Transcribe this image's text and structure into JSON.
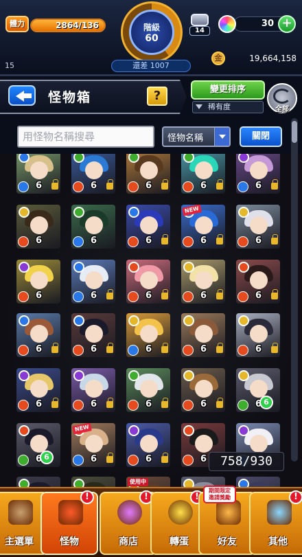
{
  "hud": {
    "stamina_label": "體力",
    "stamina_text": "2864/136",
    "stamina_fraction": 1.0,
    "rank_label": "階級",
    "rank_value": "60",
    "exp_to_next": "還差 1007",
    "orb_box_count": "14",
    "orb_count": "30",
    "plus_label": "+",
    "friend_count": "15",
    "coin_symbol": "金",
    "gold": "19,664,158"
  },
  "header": {
    "title": "怪物箱",
    "help_label": "?",
    "sort_button": "變更排序",
    "sort_by": "稀有度",
    "all_label": "全部"
  },
  "search": {
    "placeholder": "用怪物名稱搜尋",
    "field_select": "怪物名稱",
    "close_label": "關閉"
  },
  "box": {
    "count_text": "758/930",
    "new_label": "NEW",
    "inuse_label": "使用中"
  },
  "colors": {
    "accent_orange": "#f6a91e",
    "accent_blue": "#1f86ff",
    "accent_green": "#2ed14a"
  },
  "grid": {
    "rows": [
      [
        {
          "elem": "water",
          "level": "6",
          "hair": "#d7c08a",
          "bg": "#7a9a6a",
          "bottom": "water",
          "lock": true
        },
        {
          "elem": "wood",
          "level": "6",
          "hair": "#2a7ad6",
          "bg": "#3a5a9a",
          "bottom": "fire",
          "lock": true
        },
        {
          "elem": "wood",
          "level": "6",
          "hair": "#5a3a1e",
          "bg": "#b07a3a",
          "bottom": "fire",
          "lock": true
        },
        {
          "elem": "wood",
          "level": "6",
          "hair": "#2ad6b8",
          "bg": "#4a9aa8",
          "bottom": "fire",
          "lock": true
        },
        {
          "elem": "dark",
          "level": "6",
          "hair": "#c59ad6",
          "bg": "#6a4a8a",
          "bottom": "water",
          "lock": true
        }
      ],
      [
        {
          "elem": "light",
          "level": "6",
          "hair": "#3a2a1a",
          "bg": "#5a5a3a",
          "bottom": "fire",
          "lock": false
        },
        {
          "elem": "wood",
          "level": "6",
          "hair": "#1a3a2a",
          "bg": "#3a6a4a",
          "bottom": "water",
          "lock": false
        },
        {
          "elem": "water",
          "level": "6",
          "hair": "#2a3ab8",
          "bg": "#3a4aa8",
          "bottom": "fire",
          "lock": true
        },
        {
          "elem": "water",
          "level": "6",
          "hair": "#2a6ad6",
          "bg": "#3a6ac8",
          "bottom": "fire",
          "lock": true,
          "new": true
        },
        {
          "elem": "light",
          "level": "6",
          "hair": "#e0e0ea",
          "bg": "#7a8a9a",
          "bottom": "fire",
          "lock": true
        }
      ],
      [
        {
          "elem": "dark",
          "level": "6",
          "hair": "#f2d24a",
          "bg": "#9a8a3a",
          "bottom": "fire",
          "lock": false
        },
        {
          "elem": "water",
          "level": "6",
          "hair": "#e6ecf5",
          "bg": "#5a7ab8",
          "bottom": "water",
          "lock": true
        },
        {
          "elem": "fire",
          "level": "6",
          "hair": "#f09aa8",
          "bg": "#c86a7a",
          "bottom": "fire",
          "lock": true
        },
        {
          "elem": "light",
          "level": "6",
          "hair": "#f2e2a8",
          "bg": "#a89a6a",
          "bottom": "fire",
          "lock": true
        },
        {
          "elem": "fire",
          "level": "6",
          "hair": "#2a1a1a",
          "bg": "#8a4a4a",
          "bottom": "fire",
          "lock": true
        }
      ],
      [
        {
          "elem": "water",
          "level": "6",
          "hair": "#9a5a3a",
          "bg": "#5a7aa8",
          "bottom": "fire",
          "lock": true
        },
        {
          "elem": "water",
          "level": "6",
          "hair": "#1a1a2a",
          "bg": "#5a3a3a",
          "bottom": "fire",
          "lock": true
        },
        {
          "elem": "light",
          "level": "6",
          "hair": "#f2c24a",
          "bg": "#d89a3a",
          "bottom": "water",
          "lock": true
        },
        {
          "elem": "light",
          "level": "6",
          "hair": "#8a5a3a",
          "bg": "#9a7a5a",
          "bottom": "fire",
          "lock": true
        },
        {
          "elem": "light",
          "level": "6",
          "hair": "#2a2a3a",
          "bg": "#aab0c0",
          "bottom": "fire",
          "lock": true
        }
      ],
      [
        {
          "elem": "dark",
          "level": "6",
          "hair": "#e6c86a",
          "bg": "#3a4a8a",
          "bottom": "fire",
          "lock": true
        },
        {
          "elem": "dark",
          "level": "6",
          "hair": "#c8d8e6",
          "bg": "#7a5aa8",
          "bottom": "fire",
          "lock": true
        },
        {
          "elem": "wood",
          "level": "6",
          "hair": "#e0e6ea",
          "bg": "#5a8a5a",
          "bottom": "fire",
          "lock": true
        },
        {
          "elem": "light",
          "level": "6",
          "hair": "#9a6a3a",
          "bg": "#6a5a4a",
          "bottom": "fire",
          "lock": true
        },
        {
          "elem": "light",
          "level": "6",
          "hair": "#c8c8d0",
          "bg": "#5a5a6a",
          "bottom": "wood",
          "lock": false,
          "badge": "6"
        }
      ],
      [
        {
          "elem": "fire",
          "level": "6",
          "hair": "#1a1a2a",
          "bg": "#5a5a6a",
          "bottom": "wood",
          "lock": false,
          "badge": "6"
        },
        {
          "elem": "fire",
          "level": "6",
          "hair": "#d8b08a",
          "bg": "#a07a5a",
          "bottom": "water",
          "lock": true,
          "new": true
        },
        {
          "elem": "dark",
          "level": "6",
          "hair": "#2a3a8a",
          "bg": "#4a5aa8",
          "bottom": "fire",
          "lock": true
        },
        {
          "elem": "fire",
          "level": "6",
          "hair": "#1a1a1a",
          "bg": "#7a3a3a",
          "bottom": "fire",
          "lock": false
        },
        {
          "elem": "dark",
          "level": "",
          "hair": "#f0f0f5",
          "bg": "#7a8ab0",
          "bottom": "water",
          "lock": false
        }
      ],
      [
        {
          "elem": "wood",
          "level": "",
          "hair": "#1a1a2a",
          "bg": "#3a3a4a",
          "bottom": "",
          "lock": false
        },
        {
          "elem": "wood",
          "level": "",
          "hair": "#2a2a1a",
          "bg": "#4a4a3a",
          "bottom": "",
          "lock": false
        },
        {
          "elem": "fire",
          "level": "",
          "hair": "#5a3a2a",
          "bg": "#6a4a3a",
          "bottom": "",
          "lock": false,
          "inuse": true
        },
        {
          "elem": "light",
          "level": "",
          "hair": "#8a8a9a",
          "bg": "#5a5a6a",
          "bottom": "",
          "lock": false
        },
        {
          "elem": "water",
          "level": "",
          "hair": "#3a3a5a",
          "bg": "#4a4a6a",
          "bottom": "",
          "lock": false
        }
      ]
    ]
  },
  "nav": {
    "items": [
      {
        "label": "主選單",
        "icon": "home-icon",
        "color": "#c8a070",
        "badge": ""
      },
      {
        "label": "怪物",
        "icon": "monster-icon",
        "color": "#ff5a2a",
        "badge": "!",
        "active": true
      },
      {
        "label": "商店",
        "icon": "shop-orb-icon",
        "color": "#e07aff",
        "badge": "!"
      },
      {
        "label": "轉蛋",
        "icon": "gacha-egg-icon",
        "color": "#ffe04a",
        "badge": "!"
      },
      {
        "label": "好友",
        "icon": "friends-icon",
        "color": "#ffb84a",
        "badge": ""
      },
      {
        "label": "其他",
        "icon": "other-icon",
        "color": "#8ad6ff",
        "badge": "!"
      }
    ],
    "event_text_1": "期間限定",
    "event_text_2": "邀請獎勵"
  }
}
